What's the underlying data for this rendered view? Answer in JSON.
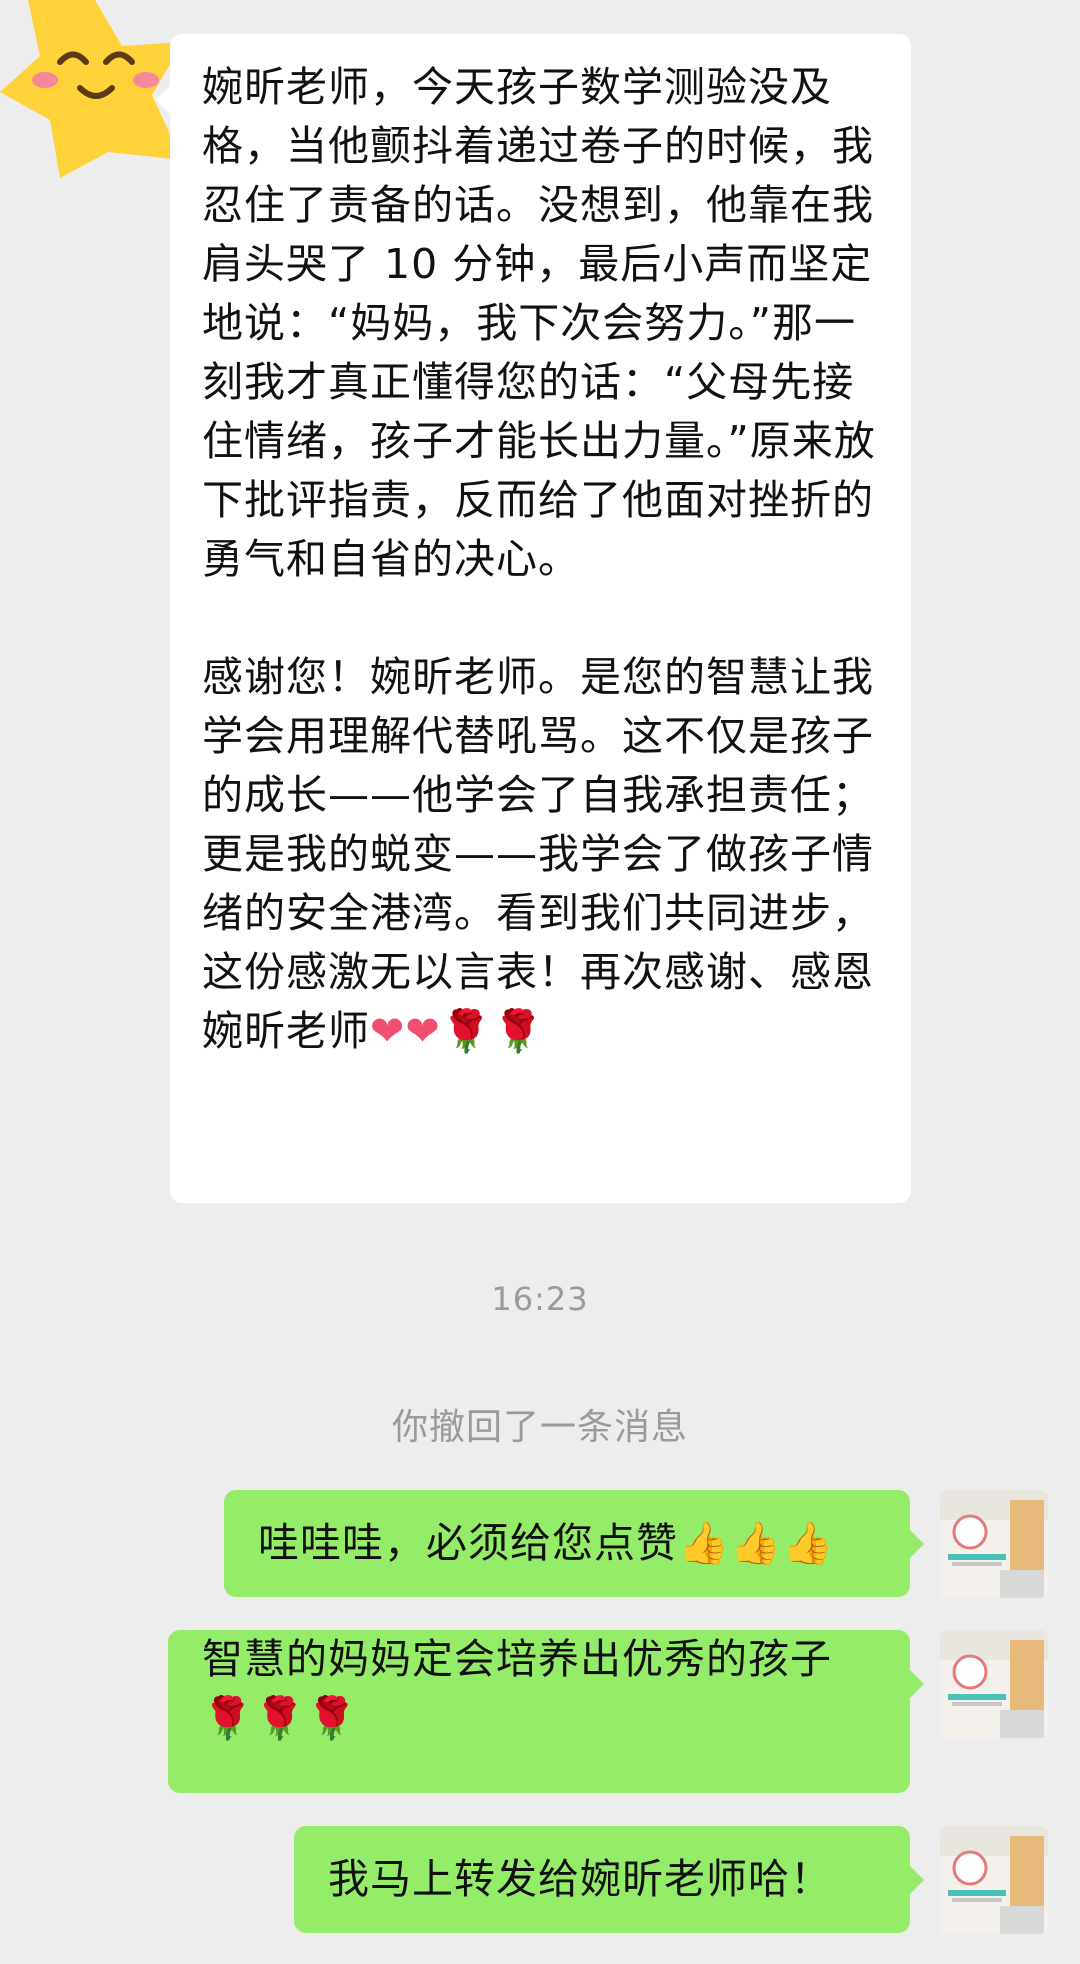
{
  "incoming": {
    "avatar_icon": "smiling-star-avatar",
    "paragraph_1": "婉昕老师，今天孩子数学测验没及格，当他颤抖着递过卷子的时候，我忍住了责备的话。没想到，他靠在我肩头哭了 10 分钟，最后小声而坚定地说：“妈妈，我下次会努力。”那一刻我才真正懂得您的话：“父母先接住情绪，孩子才能长出力量。”原来放下批评指责，反而给了他面对挫折的勇气和自省的决心。",
    "paragraph_2": "感谢您！婉昕老师。是您的智慧让我学会用理解代替吼骂。这不仅是孩子的成长——他学会了自我承担责任；更是我的蜕变——我学会了做孩子情绪的安全港湾。看到我们共同进步，这份感激无以言表！再次感谢、感恩婉昕老师",
    "paragraph_2_emoji": "❤❤🌹🌹"
  },
  "time_divider": "16:23",
  "recall_notice": "你撤回了一条消息",
  "outgoing": [
    {
      "text": "哇哇哇，必须给您点赞",
      "emoji": "👍👍👍"
    },
    {
      "text": "智慧的妈妈定会培养出优秀的孩子",
      "emoji": "🌹🌹🌹"
    },
    {
      "text": "我马上转发给婉昕老师哈！",
      "emoji": ""
    }
  ],
  "colors": {
    "background": "#ededed",
    "incoming_bubble": "#ffffff",
    "outgoing_bubble": "#95ec69",
    "system_text": "#9a9a9a"
  }
}
